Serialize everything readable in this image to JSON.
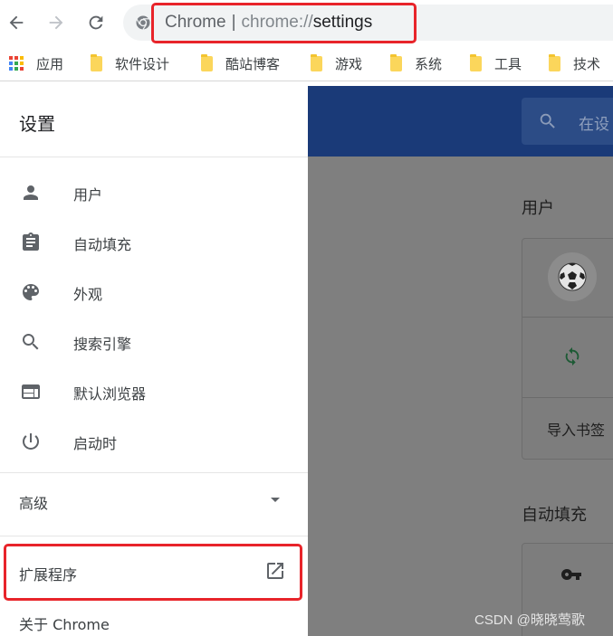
{
  "browser": {
    "omnibox": {
      "origin": "Chrome",
      "separator": "|",
      "scheme": "chrome://",
      "path": "settings"
    },
    "bookmarks": [
      {
        "label": "应用",
        "icon": "apps-grid-icon"
      },
      {
        "label": "软件设计",
        "icon": "folder-icon"
      },
      {
        "label": "酷站博客",
        "icon": "folder-icon"
      },
      {
        "label": "游戏",
        "icon": "folder-icon"
      },
      {
        "label": "系统",
        "icon": "folder-icon"
      },
      {
        "label": "工具",
        "icon": "folder-icon"
      },
      {
        "label": "技术",
        "icon": "folder-icon"
      }
    ]
  },
  "sidebar": {
    "title": "设置",
    "items": [
      {
        "label": "用户",
        "icon": "person-icon"
      },
      {
        "label": "自动填充",
        "icon": "clipboard-icon"
      },
      {
        "label": "外观",
        "icon": "palette-icon"
      },
      {
        "label": "搜索引擎",
        "icon": "search-icon"
      },
      {
        "label": "默认浏览器",
        "icon": "browser-window-icon"
      },
      {
        "label": "启动时",
        "icon": "power-icon"
      }
    ],
    "advanced": "高级",
    "extensions": "扩展程序",
    "about": "关于 Chrome"
  },
  "main": {
    "search_placeholder": "在设",
    "section_people": "用户",
    "import_bookmarks": "导入书签",
    "section_autofill": "自动填充"
  },
  "watermark": "CSDN @晓晓莺歌",
  "colors": {
    "highlight": "#e8242a",
    "header_blue": "#1a3a78",
    "overlay_gray": "#7f7f7f"
  }
}
